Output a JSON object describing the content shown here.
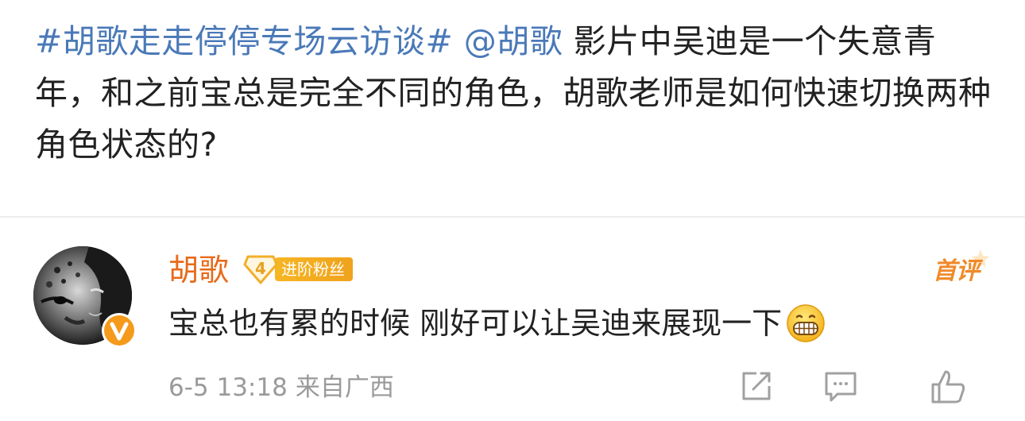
{
  "post": {
    "topic": "#胡歌走走停停专场云访谈#",
    "mention": "@胡歌",
    "text": " 影片中吴迪是一个失意青年，和之前宝总是完全不同的角色，胡歌老师是如何快速切换两种角色状态的?"
  },
  "comment": {
    "author": "胡歌",
    "fan_level": "4",
    "fan_label": "进阶粉丝",
    "first_comment_badge": "首评",
    "text": "宝总也有累的时候 刚好可以让吴迪来展现一下",
    "emoji": "grinning-face-emoji",
    "time": "6-5 13:18",
    "location": "来自广西",
    "avatar": "snow-leopard-portrait",
    "verified_badge": "v-badge-icon"
  },
  "colors": {
    "link": "#4a79b8",
    "author": "#e86a1a",
    "badge": "#f6b623",
    "meta": "#9a9a9a"
  },
  "actions": [
    "share-icon",
    "comment-icon",
    "like-icon"
  ]
}
